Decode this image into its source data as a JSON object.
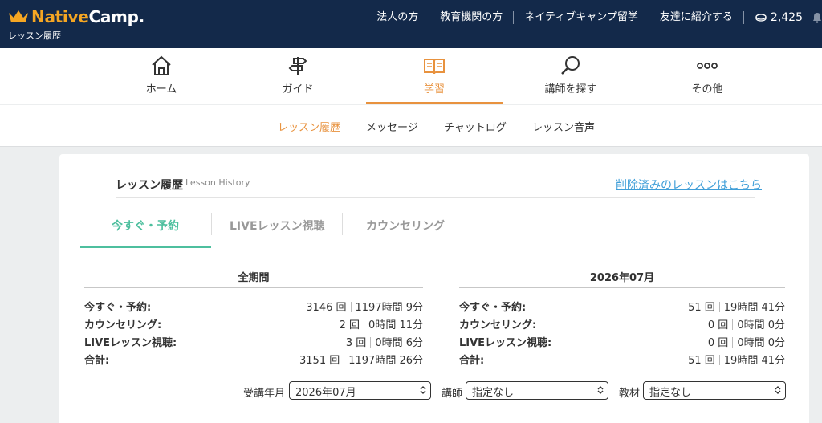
{
  "header": {
    "brand_native": "Native",
    "brand_camp": "Camp.",
    "subtitle": "レッスン履歴",
    "links": [
      "法人の方",
      "教育機関の方",
      "ネイティブキャンプ留学",
      "友達に紹介する"
    ],
    "coins": "2,425",
    "coin_icon": "coin-icon",
    "bell_icon": "bell-icon"
  },
  "nav": {
    "items": [
      {
        "label": "ホーム",
        "icon": "home-icon"
      },
      {
        "label": "ガイド",
        "icon": "signpost-icon"
      },
      {
        "label": "学習",
        "icon": "book-icon"
      },
      {
        "label": "講師を探す",
        "icon": "search-icon"
      },
      {
        "label": "その他",
        "icon": "more-icon"
      }
    ],
    "active_index": 2,
    "active_color": "#e8923e"
  },
  "subnav": {
    "items": [
      "レッスン履歴",
      "メッセージ",
      "チャットログ",
      "レッスン音声"
    ],
    "active_index": 0
  },
  "card": {
    "title": "レッスン履歴",
    "title_en": "Lesson History",
    "deleted_link": "削除済みのレッスンはこちら",
    "tabs": [
      "今すぐ・予約",
      "LIVEレッスン視聴",
      "カウンセリング"
    ],
    "active_tab": 0,
    "accent_color": "#4dbf9e"
  },
  "stats": {
    "all": {
      "heading": "全期間",
      "rows": [
        {
          "label": "今すぐ・予約:",
          "count": "3146 回",
          "time": "1197時間 9分"
        },
        {
          "label": "カウンセリング:",
          "count": "2 回",
          "time": "0時間 11分"
        },
        {
          "label": "LIVEレッスン視聴:",
          "count": "3 回",
          "time": "0時間 6分"
        },
        {
          "label": "合計:",
          "count": "3151 回",
          "time": "1197時間 26分"
        }
      ]
    },
    "month": {
      "heading": "2026年07月",
      "rows": [
        {
          "label": "今すぐ・予約:",
          "count": "51 回",
          "time": "19時間 41分"
        },
        {
          "label": "カウンセリング:",
          "count": "0 回",
          "time": "0時間 0分"
        },
        {
          "label": "LIVEレッスン視聴:",
          "count": "0 回",
          "time": "0時間 0分"
        },
        {
          "label": "合計:",
          "count": "51 回",
          "time": "19時間 41分"
        }
      ]
    }
  },
  "filters": {
    "month_label": "受講年月",
    "month_value": "2026年07月",
    "teacher_label": "講師",
    "teacher_value": "指定なし",
    "material_label": "教材",
    "material_value": "指定なし"
  }
}
